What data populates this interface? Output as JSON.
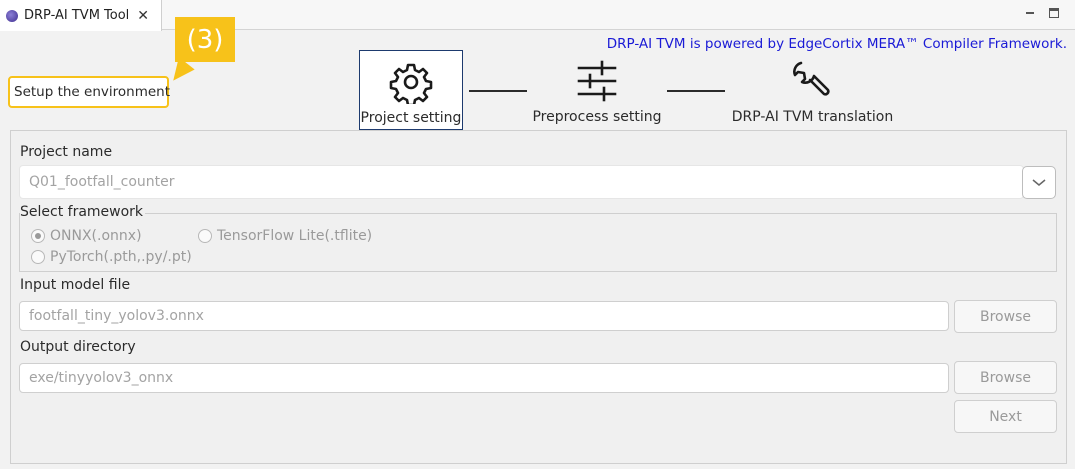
{
  "tab": {
    "title": "DRP-AI TVM Tool",
    "close": "✕"
  },
  "header": {
    "powered_by": "DRP-AI TVM is powered by EdgeCortix MERA™ Compiler Framework.",
    "callout": "(3)",
    "setup_label": "Setup the environment"
  },
  "steps": [
    {
      "label": "Project setting",
      "icon": "gear-icon",
      "active": true
    },
    {
      "label": "Preprocess setting",
      "icon": "sliders-icon",
      "active": false
    },
    {
      "label": "DRP-AI TVM translation",
      "icon": "wrench-icon",
      "active": false
    }
  ],
  "form": {
    "project_name_label": "Project name",
    "project_name_value": "Q01_footfall_counter",
    "framework_label": "Select framework",
    "frameworks": [
      {
        "label": "ONNX(.onnx)",
        "selected": true
      },
      {
        "label": "TensorFlow Lite(.tflite)",
        "selected": false
      },
      {
        "label": "PyTorch(.pth,.py/.pt)",
        "selected": false
      }
    ],
    "input_model_label": "Input model file",
    "input_model_value": "footfall_tiny_yolov3.onnx",
    "output_dir_label": "Output directory",
    "output_dir_value": "exe/tinyyolov3_onnx",
    "browse_label": "Browse",
    "next_label": "Next"
  },
  "colors": {
    "accent_callout": "#f7c21a",
    "powered_text": "#1a1ad6",
    "active_step_border": "#1d3a6e"
  }
}
